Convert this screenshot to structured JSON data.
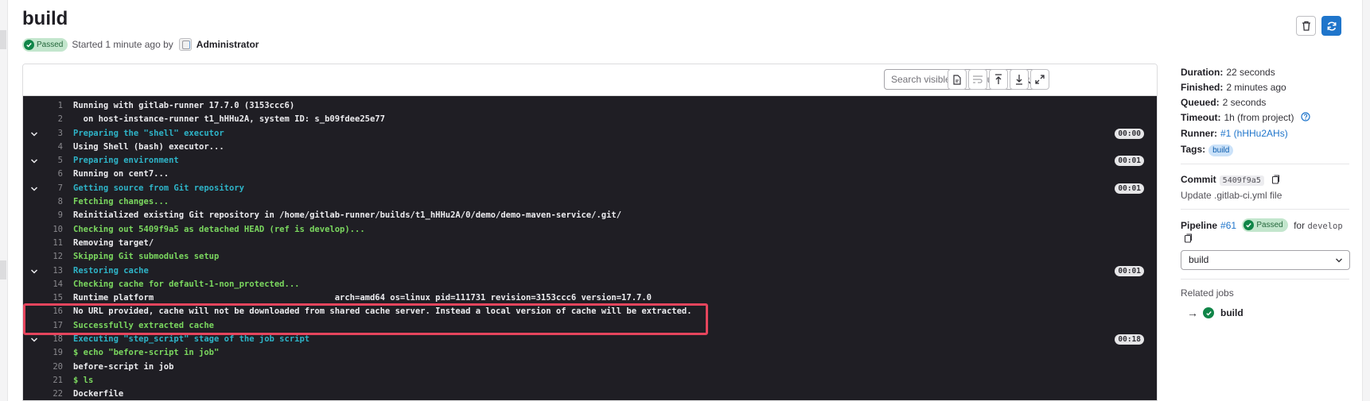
{
  "job": {
    "title": "build",
    "status": "Passed",
    "started_text": "Started 1 minute ago by",
    "user": "Administrator"
  },
  "toolbar": {
    "search_placeholder": "Search visible log output",
    "icons": [
      "search-icon",
      "raw-log-icon",
      "wrap-lines-icon",
      "scroll-top-icon",
      "scroll-bottom-icon",
      "fullscreen-icon"
    ]
  },
  "log": [
    {
      "n": "1",
      "text": "Running with gitlab-runner 17.7.0 (3153ccc6)",
      "style": "white",
      "section": false,
      "dur": ""
    },
    {
      "n": "2",
      "text": "  on host-instance-runner t1_hHHu2A, system ID: s_b09fdee25e77",
      "style": "white",
      "section": false,
      "dur": ""
    },
    {
      "n": "3",
      "text": "Preparing the \"shell\" executor",
      "style": "cyan",
      "section": true,
      "dur": "00:00"
    },
    {
      "n": "4",
      "text": "Using Shell (bash) executor...",
      "style": "white",
      "section": false,
      "dur": ""
    },
    {
      "n": "5",
      "text": "Preparing environment",
      "style": "cyan",
      "section": true,
      "dur": "00:01"
    },
    {
      "n": "6",
      "text": "Running on cent7...",
      "style": "white",
      "section": false,
      "dur": ""
    },
    {
      "n": "7",
      "text": "Getting source from Git repository",
      "style": "cyan",
      "section": true,
      "dur": "00:01"
    },
    {
      "n": "8",
      "text": "Fetching changes...",
      "style": "green",
      "section": false,
      "dur": ""
    },
    {
      "n": "9",
      "text": "Reinitialized existing Git repository in /home/gitlab-runner/builds/t1_hHHu2A/0/demo/demo-maven-service/.git/",
      "style": "white",
      "section": false,
      "dur": ""
    },
    {
      "n": "10",
      "text": "Checking out 5409f9a5 as detached HEAD (ref is develop)...",
      "style": "green",
      "section": false,
      "dur": ""
    },
    {
      "n": "11",
      "text": "Removing target/",
      "style": "white",
      "section": false,
      "dur": ""
    },
    {
      "n": "12",
      "text": "Skipping Git submodules setup",
      "style": "green",
      "section": false,
      "dur": ""
    },
    {
      "n": "13",
      "text": "Restoring cache",
      "style": "cyan",
      "section": true,
      "dur": "00:01"
    },
    {
      "n": "14",
      "text": "Checking cache for default-1-non_protected...",
      "style": "green",
      "section": false,
      "dur": ""
    },
    {
      "n": "15",
      "text": "Runtime platform                                    arch=amd64 os=linux pid=111731 revision=3153ccc6 version=17.7.0",
      "style": "white",
      "section": false,
      "dur": ""
    },
    {
      "n": "16",
      "text": "No URL provided, cache will not be downloaded from shared cache server. Instead a local version of cache will be extracted.",
      "style": "white",
      "section": false,
      "dur": ""
    },
    {
      "n": "17",
      "text": "Successfully extracted cache",
      "style": "green",
      "section": false,
      "dur": ""
    },
    {
      "n": "18",
      "text": "Executing \"step_script\" stage of the job script",
      "style": "cyan",
      "section": true,
      "dur": "00:18"
    },
    {
      "n": "19",
      "text": "$ echo \"before-script in job\"",
      "style": "green",
      "section": false,
      "dur": ""
    },
    {
      "n": "20",
      "text": "before-script in job",
      "style": "white",
      "section": false,
      "dur": ""
    },
    {
      "n": "21",
      "text": "$ ls",
      "style": "green",
      "section": false,
      "dur": ""
    },
    {
      "n": "22",
      "text": "Dockerfile",
      "style": "white",
      "section": false,
      "dur": ""
    }
  ],
  "sidebar": {
    "duration_label": "Duration:",
    "duration": "22 seconds",
    "finished_label": "Finished:",
    "finished": "2 minutes ago",
    "queued_label": "Queued:",
    "queued": "2 seconds",
    "timeout_label": "Timeout:",
    "timeout": "1h (from project)",
    "runner_label": "Runner:",
    "runner": "#1 (hHHu2AHs)",
    "tags_label": "Tags:",
    "tag": "build",
    "commit_label": "Commit",
    "commit_sha": "5409f9a5",
    "commit_message": "Update .gitlab-ci.yml file",
    "pipeline_label": "Pipeline",
    "pipeline_id": "#61",
    "pipeline_status": "Passed",
    "pipeline_for": "for",
    "pipeline_ref": "develop",
    "stage_select": "build",
    "related_jobs_label": "Related jobs",
    "related_job_arrow": "→",
    "related_job": "build"
  },
  "colors": {
    "accent": "#1f75cb",
    "success": "#108548",
    "log_bg": "#1f1e24",
    "highlight": "#e5455d"
  }
}
